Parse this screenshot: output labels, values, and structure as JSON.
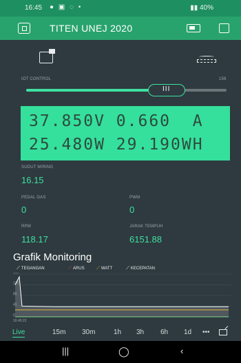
{
  "status_bar": {
    "time": "16:45",
    "right_text": "40%"
  },
  "app_bar": {
    "title": "TITEN UNEJ 2020"
  },
  "slider": {
    "label": "IOT CONTROL",
    "max_label": "156",
    "fraction": 0.7,
    "thumb_glyph": "III"
  },
  "lcd": {
    "line1": "37.850V 0.660  A",
    "line2": "25.480W 29.190WH"
  },
  "readings": {
    "sudut": {
      "label": "SUDUT MIRING",
      "value": "16.15"
    },
    "pedal": {
      "label": "PEDAL GAS",
      "value": "0"
    },
    "pwm": {
      "label": "PWM",
      "value": "0"
    },
    "rpm": {
      "label": "RPM",
      "value": "118.17"
    },
    "jarak": {
      "label": "JARAK TEMPUH",
      "value": "6151.88"
    }
  },
  "chart": {
    "title": "Grafik Monitoring",
    "legend": [
      "TEGANGAN",
      "ARUS",
      "WATT",
      "KECEPATAN"
    ],
    "y_ticks": [
      "160",
      "120",
      "80",
      "40",
      "0"
    ],
    "x_start_label": "16:45:22"
  },
  "chart_data": {
    "type": "line",
    "title": "Grafik Monitoring",
    "ylim": [
      0,
      160
    ],
    "yticks": [
      0,
      40,
      80,
      120,
      160
    ],
    "series": [
      {
        "name": "TEGANGAN",
        "color": "#ffffff",
        "values": [
          120,
          150,
          40,
          38,
          38,
          38,
          38,
          38,
          38
        ]
      },
      {
        "name": "ARUS",
        "color": "#e05a5a",
        "values": [
          1,
          1,
          1,
          1,
          1,
          1,
          1,
          1,
          1
        ]
      },
      {
        "name": "WATT",
        "color": "#e8b23a",
        "values": [
          26,
          26,
          26,
          26,
          26,
          26,
          26,
          26,
          26
        ]
      },
      {
        "name": "KECEPATAN",
        "color": "#4fd08a",
        "values": [
          0,
          0,
          0,
          0,
          0,
          0,
          0,
          0,
          0
        ]
      }
    ],
    "grid": true
  },
  "time_tabs": [
    "Live",
    "15m",
    "30m",
    "1h",
    "3h",
    "6h",
    "1d",
    "•••"
  ],
  "colors": {
    "accent": "#3fe0a0",
    "appbar": "#29a36d",
    "background": "#2e3a3f"
  }
}
